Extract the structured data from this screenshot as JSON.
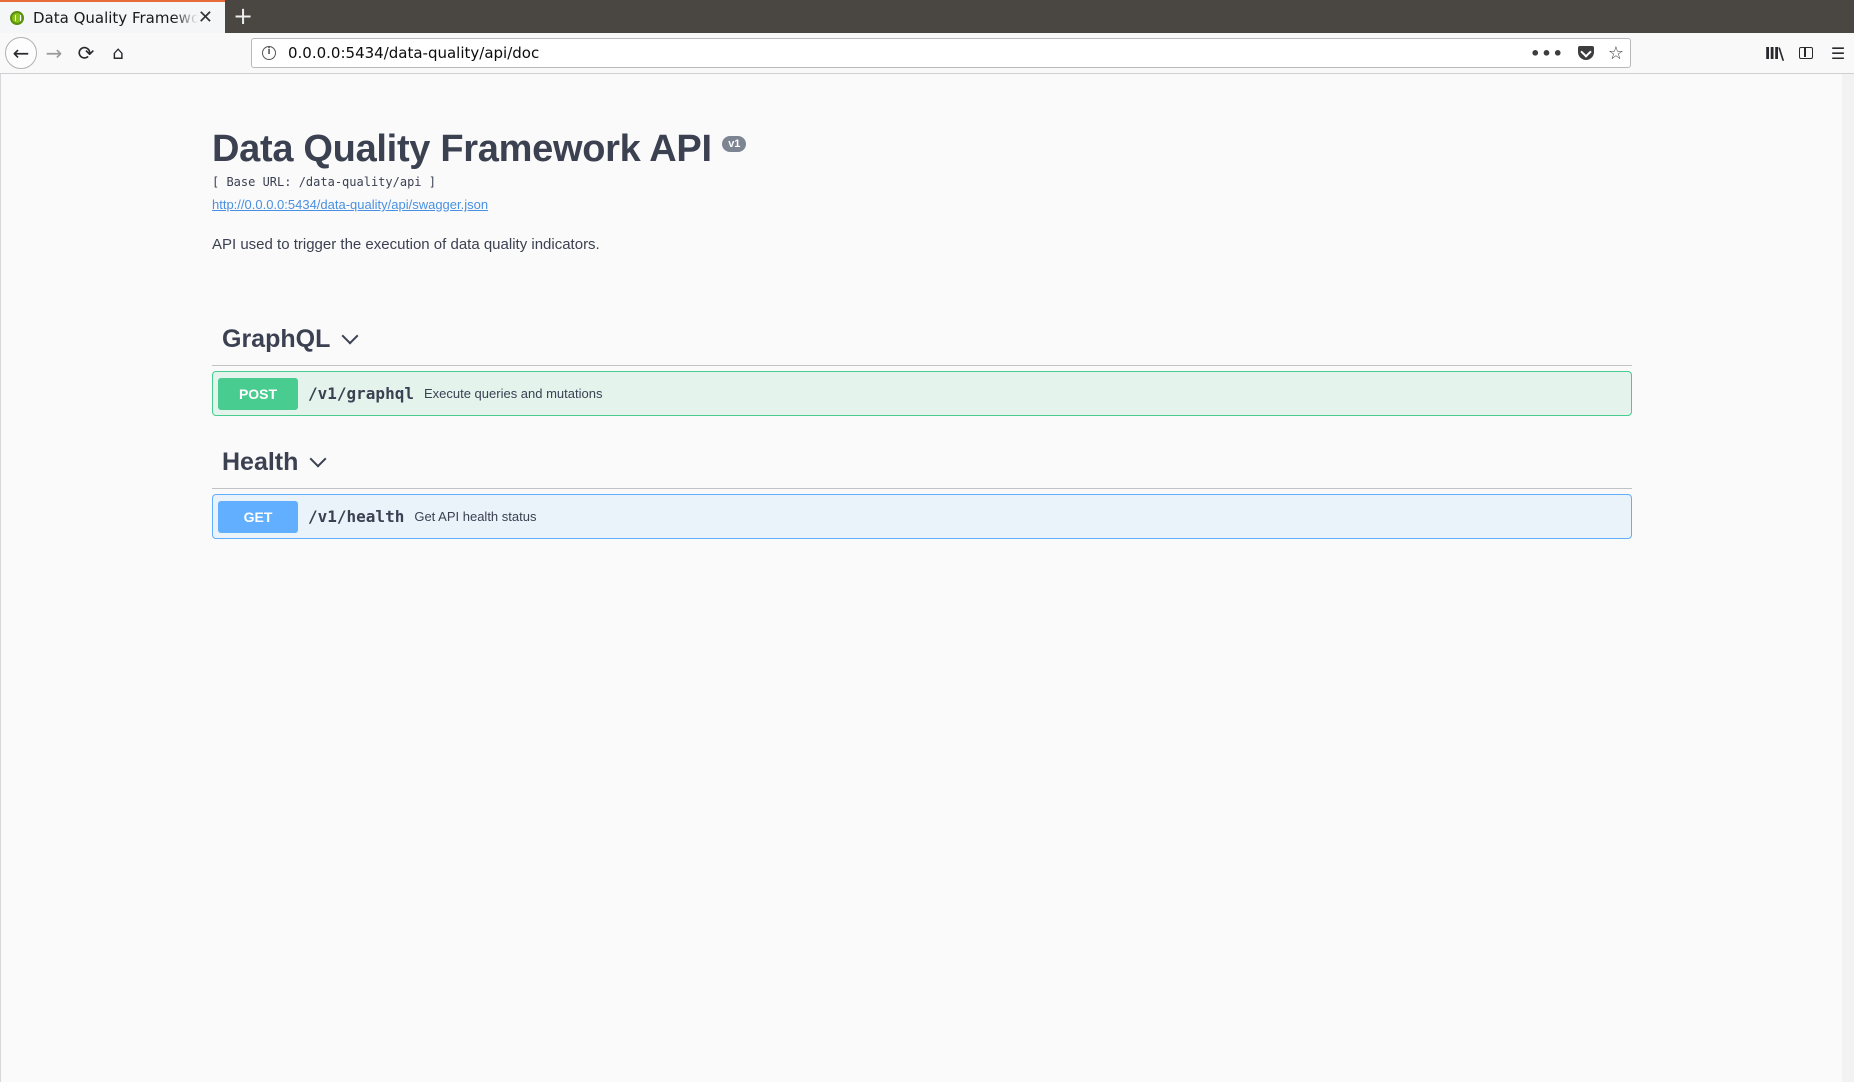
{
  "browser": {
    "tab_title": "Data Quality Framework API",
    "close_glyph": "✕",
    "newtab_glyph": "+",
    "url": "0.0.0.0:5434/data-quality/api/doc",
    "back_glyph": "←",
    "forward_glyph": "→",
    "reload_glyph": "⟳",
    "home_glyph": "⌂",
    "more_glyph": "•••",
    "star_glyph": "☆",
    "library_glyph": "lll\\",
    "menu_glyph": "☰"
  },
  "info": {
    "title": "Data Quality Framework API",
    "version": "v1",
    "base_url": "[ Base URL: /data-quality/api ]",
    "spec_link": "http://0.0.0.0:5434/data-quality/api/swagger.json",
    "description": "API used to trigger the execution of data quality indicators."
  },
  "tags": [
    {
      "name": "GraphQL",
      "operation": {
        "method": "POST",
        "path": "/v1/graphql",
        "summary": "Execute queries and mutations"
      }
    },
    {
      "name": "Health",
      "operation": {
        "method": "GET",
        "path": "/v1/health",
        "summary": "Get API health status"
      }
    }
  ],
  "colors": {
    "post": "#49cc90",
    "get": "#61affe",
    "text": "#3b4151",
    "link": "#4990e2",
    "tab_accent": "#e76a3a"
  }
}
